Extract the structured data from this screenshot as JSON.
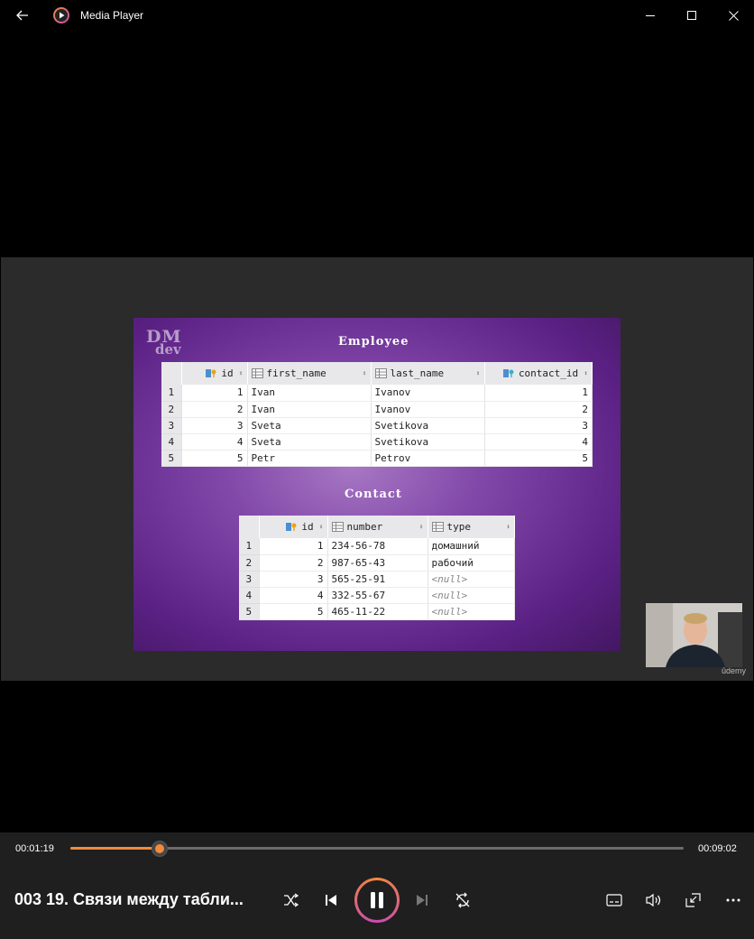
{
  "window": {
    "title": "Media Player",
    "icons": {
      "back": "back-arrow-icon",
      "app": "media-player-icon",
      "minimize": "minimize-icon",
      "maximize": "maximize-icon",
      "close": "close-icon"
    }
  },
  "slide": {
    "logo_top": "DM",
    "logo_bottom": "dev",
    "employee_title": "Employee",
    "contact_title": "Contact",
    "employee_table": {
      "columns": [
        "id",
        "first_name",
        "last_name",
        "contact_id"
      ],
      "rows": [
        {
          "row": "1",
          "id": "1",
          "first_name": "Ivan",
          "last_name": "Ivanov",
          "contact_id": "1"
        },
        {
          "row": "2",
          "id": "2",
          "first_name": "Ivan",
          "last_name": "Ivanov",
          "contact_id": "2"
        },
        {
          "row": "3",
          "id": "3",
          "first_name": "Sveta",
          "last_name": "Svetikova",
          "contact_id": "3"
        },
        {
          "row": "4",
          "id": "4",
          "first_name": "Sveta",
          "last_name": "Svetikova",
          "contact_id": "4"
        },
        {
          "row": "5",
          "id": "5",
          "first_name": "Petr",
          "last_name": "Petrov",
          "contact_id": "5"
        }
      ]
    },
    "contact_table": {
      "columns": [
        "id",
        "number",
        "type"
      ],
      "rows": [
        {
          "row": "1",
          "id": "1",
          "number": "234-56-78",
          "type": "домашний"
        },
        {
          "row": "2",
          "id": "2",
          "number": "987-65-43",
          "type": "рабочий"
        },
        {
          "row": "3",
          "id": "3",
          "number": "565-25-91",
          "type": "<null>"
        },
        {
          "row": "4",
          "id": "4",
          "number": "332-55-67",
          "type": "<null>"
        },
        {
          "row": "5",
          "id": "5",
          "number": "465-11-22",
          "type": "<null>"
        }
      ]
    },
    "watermark": "ûdemy"
  },
  "player": {
    "current_time": "00:01:19",
    "total_time": "00:09:02",
    "progress": 0.146,
    "media_title": "003 19. Связи между табли...",
    "accent": "#f28a3b",
    "buttons": [
      "shuffle-icon",
      "previous-icon",
      "pause-icon",
      "next-icon",
      "repeat-off-icon",
      "subtitles-icon",
      "volume-icon",
      "miniplayer-icon",
      "more-icon"
    ]
  }
}
